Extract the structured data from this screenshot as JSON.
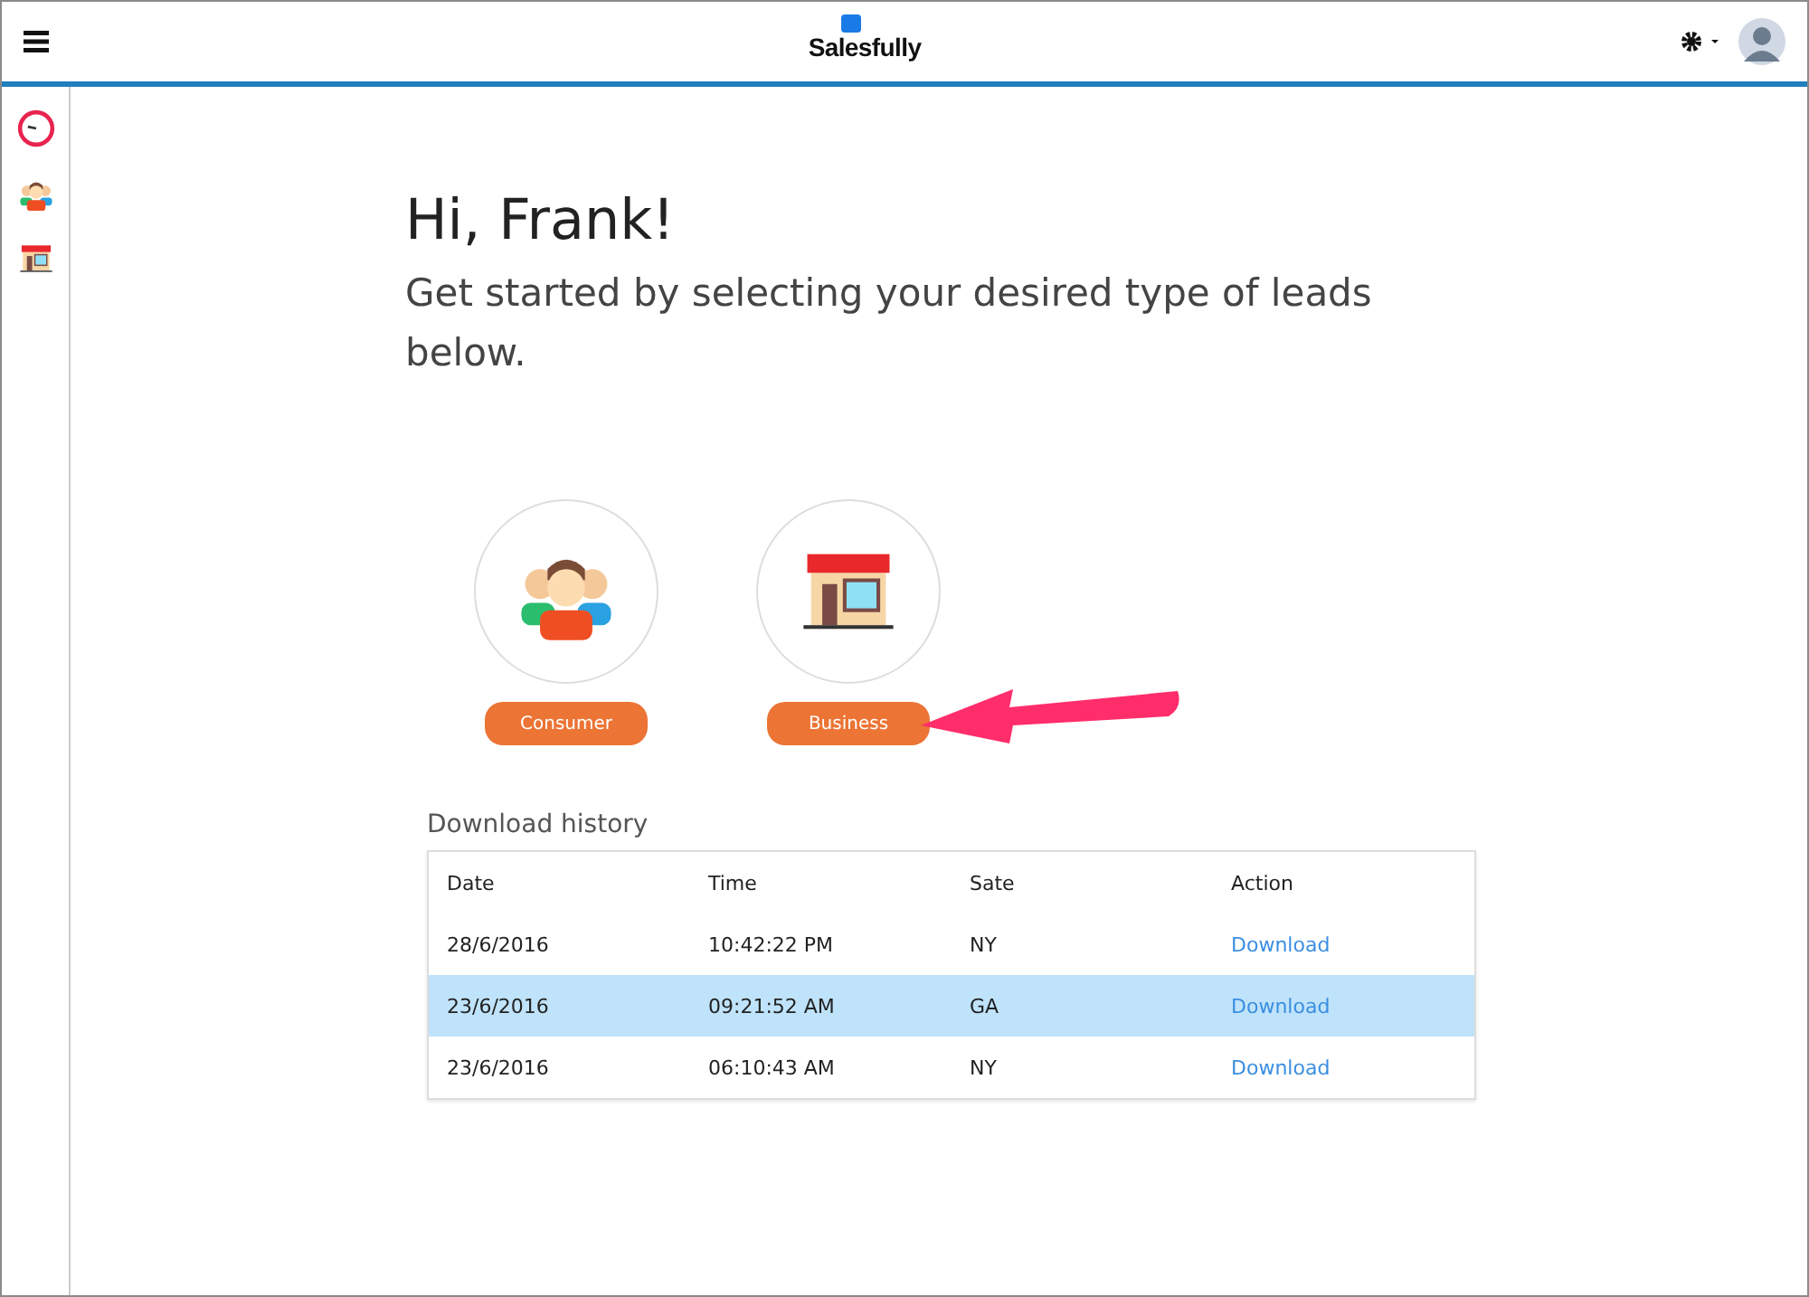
{
  "header": {
    "logo": "Salesfully"
  },
  "sidebar": {
    "items": [
      {
        "kind": "gauge"
      },
      {
        "kind": "people"
      },
      {
        "kind": "store"
      }
    ]
  },
  "greeting": "Hi, Frank!",
  "subtitle": "Get started by selecting your desired type of leads below.",
  "lead_types": [
    {
      "kind": "people",
      "label": "Consumer"
    },
    {
      "kind": "store",
      "label": "Business"
    }
  ],
  "history": {
    "title": "Download history",
    "columns": [
      "Date",
      "Time",
      "Sate",
      "Action"
    ],
    "rows": [
      {
        "cells": [
          "28/6/2016",
          "10:42:22 PM",
          "NY"
        ],
        "action": "Download",
        "selected": false
      },
      {
        "cells": [
          "23/6/2016",
          "09:21:52 AM",
          "GA"
        ],
        "action": "Download",
        "selected": true
      },
      {
        "cells": [
          "23/6/2016",
          "06:10:43 AM",
          "NY"
        ],
        "action": "Download",
        "selected": false
      }
    ]
  }
}
